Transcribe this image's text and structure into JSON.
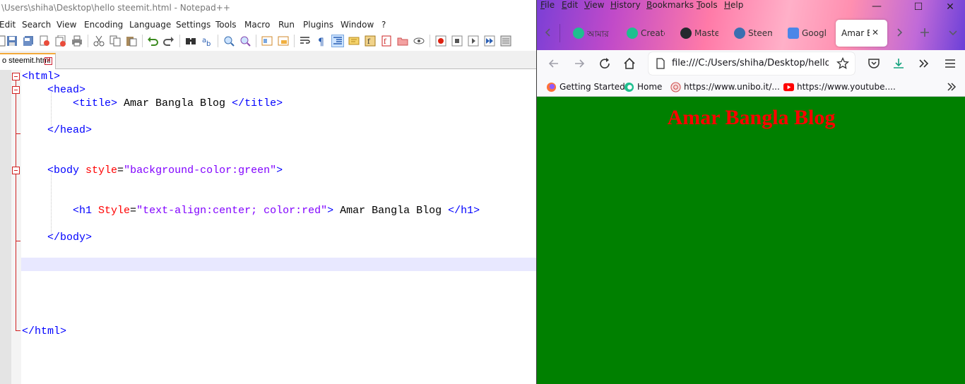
{
  "notepad": {
    "title": "\\Users\\shiha\\Desktop\\hello steemit.html - Notepad++",
    "menu": [
      "Edit",
      "Search",
      "View",
      "Encoding",
      "Language",
      "Settings",
      "Tools",
      "Macro",
      "Run",
      "Plugins",
      "Window",
      "?"
    ],
    "toolbar_icons": [
      "new-file-icon",
      "open-file-icon",
      "save-icon",
      "save-all-icon",
      "close-icon",
      "close-all-icon",
      "print-icon",
      "cut-icon",
      "copy-icon",
      "paste-icon",
      "undo-icon",
      "redo-icon",
      "find-icon",
      "replace-icon",
      "zoom-in-icon",
      "zoom-out-icon",
      "sync-vertical-icon",
      "sync-horizontal-icon",
      "word-wrap-icon",
      "show-all-chars-icon",
      "indent-guide-icon",
      "doc-map-icon",
      "function-list-icon",
      "folder-workspace-icon",
      "monitor-icon",
      "record-macro-icon",
      "stop-macro-icon",
      "play-macro-icon",
      "run-macro-multiple-icon",
      "save-macro-icon"
    ],
    "tab": {
      "label": "o steemit.html",
      "close": "✕"
    },
    "code": {
      "l1_tag": "<html>",
      "l2_tag": "<head>",
      "l3_open": "<title>",
      "l3_text": " Amar Bangla Blog ",
      "l3_close": "</title>",
      "l5_tag": "</head>",
      "l8_open": "<body",
      "l8_attr": " style",
      "l8_eq": "=",
      "l8_val": "\"background-color:green\"",
      "l8_close": ">",
      "l11_open": "<h1",
      "l11_attr": " Style",
      "l11_eq": "=",
      "l11_val": "\"text-align:center; color:red\"",
      "l11_close": ">",
      "l11_text": " Amar Bangla Blog ",
      "l11_end": "</h1>",
      "l13_tag": "</body>",
      "l20_tag": "</html>"
    }
  },
  "firefox": {
    "menu": [
      "File",
      "Edit",
      "View",
      "History",
      "Bookmarks",
      "Tools",
      "Help"
    ],
    "window_buttons": {
      "minimize": "—",
      "maximize": "☐",
      "close": "✕"
    },
    "tabs": [
      {
        "label": "আমার",
        "icon": "steemit-icon",
        "color": "#1fbf8f"
      },
      {
        "label": "Create",
        "icon": "steemit-icon",
        "color": "#1fbf8f"
      },
      {
        "label": "Maste",
        "icon": "github-icon",
        "color": "#24292e"
      },
      {
        "label": "Steem",
        "icon": "wordpress-icon",
        "color": "#3a6fb0"
      },
      {
        "label": "Googl",
        "icon": "google-translate-icon",
        "color": "#4a86e8"
      }
    ],
    "active_tab": {
      "label": "Amar B",
      "close": "✕"
    },
    "url": "file:///C:/Users/shiha/Desktop/hello steemit.html",
    "bookmarks": [
      {
        "label": "Getting Started",
        "icon": "firefox-icon"
      },
      {
        "label": "Home",
        "icon": "steemit-icon"
      },
      {
        "label": "https://www.unibo.it/...",
        "icon": "unibo-icon"
      },
      {
        "label": "https://www.youtube....",
        "icon": "youtube-icon"
      }
    ],
    "page": {
      "heading": "Amar Bangla Blog",
      "background": "#008000",
      "heading_color": "#ff0000"
    }
  }
}
